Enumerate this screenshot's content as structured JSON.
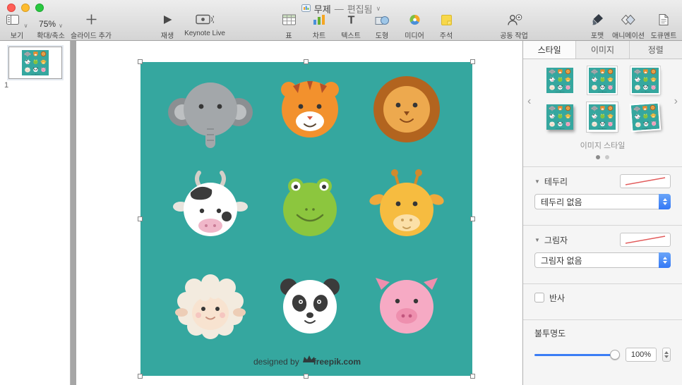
{
  "colors": {
    "teal_background": "#35A79F",
    "accent_blue": "#3478F6",
    "line_well_red": "#E25C5C",
    "window_chrome": "#EDEDED"
  },
  "glyphs": {
    "chevron_down": "∨",
    "prev": "‹",
    "next": "›",
    "disclosure": "▼",
    "text_tool": "T"
  },
  "titlebar": {
    "title": "무제",
    "separator": "—",
    "status": "편집됨"
  },
  "toolbar": {
    "view": {
      "label": "보기"
    },
    "zoom": {
      "value": "75%",
      "label": "확대/축소"
    },
    "add_slide": {
      "label": "슬라이드 추가"
    },
    "play": {
      "label": "재생"
    },
    "keynote_live": {
      "label": "Keynote Live"
    },
    "table": {
      "label": "표"
    },
    "chart": {
      "label": "차트"
    },
    "text": {
      "label": "텍스트"
    },
    "shape": {
      "label": "도형"
    },
    "media": {
      "label": "미디어"
    },
    "comment": {
      "label": "주석"
    },
    "collaborate": {
      "label": "공동 작업"
    },
    "format": {
      "label": "포맷",
      "selected": true
    },
    "animate": {
      "label": "애니메이션"
    },
    "document": {
      "label": "도큐멘트"
    }
  },
  "navigator": {
    "slides": [
      {
        "number": "1",
        "selected": true
      }
    ]
  },
  "slide": {
    "animals": [
      "elephant",
      "tiger",
      "lion",
      "cow",
      "frog",
      "giraffe",
      "sheep",
      "panda",
      "pig"
    ],
    "credit_prefix": "designed by",
    "credit_brand": "freepik.com",
    "credit_logo_icon": "freepik-crown-icon"
  },
  "inspector": {
    "tabs": [
      {
        "label": "스타일",
        "selected": true
      },
      {
        "label": "이미지",
        "selected": false
      },
      {
        "label": "정렬",
        "selected": false
      }
    ],
    "image_styles": {
      "caption": "이미지 스타일",
      "pages": 2,
      "active_page": 1,
      "visible_styles": 6
    },
    "border": {
      "title": "테두리",
      "value": "테두리 없음"
    },
    "shadow": {
      "title": "그림자",
      "value": "그림자 없음"
    },
    "reflection": {
      "label": "반사",
      "checked": false
    },
    "opacity": {
      "label": "불투명도",
      "value": "100%",
      "percent": 100
    }
  }
}
